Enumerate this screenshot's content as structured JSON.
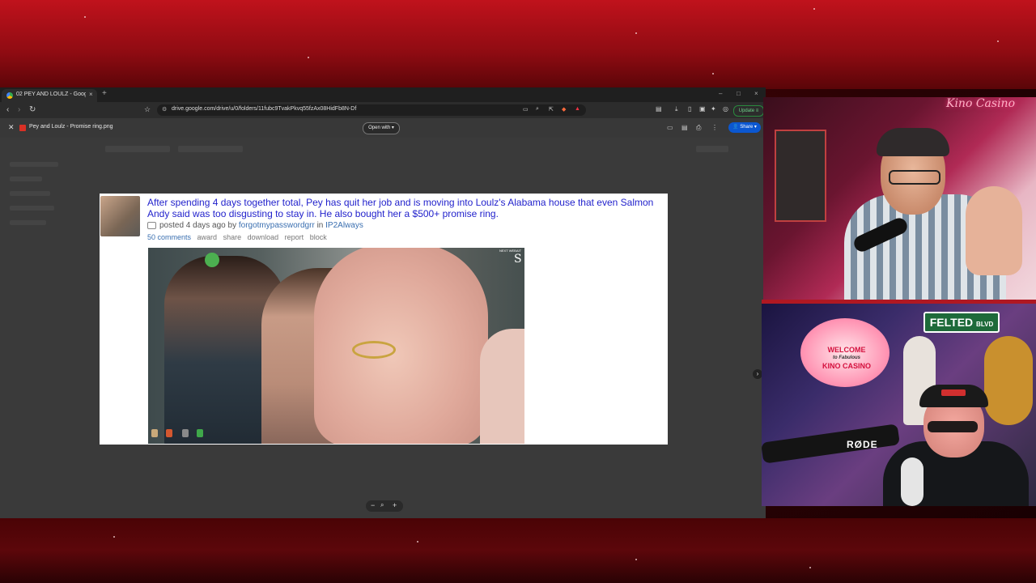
{
  "browser": {
    "tab_title": "02 PEY AND LOULZ - Google Dr",
    "tab_close": "×",
    "tab_new": "+",
    "url": "drive.google.com/drive/u/0/folders/11fubc9TvakPkvq55fzAx08HidFb8N-Df",
    "update_label": "Update"
  },
  "viewer": {
    "file_title": "Pey and Loulz - Promise ring.png",
    "open_with": "Open with",
    "share_label": "Share",
    "zoom_out": "−",
    "zoom_in": "+"
  },
  "post": {
    "title": "After spending 4 days together total, Pey has quit her job and is moving into Loulz's Alabama house that even Salmon Andy said was too disgusting to stay in. He also bought her a $500+ promise ring.",
    "posted": "posted 4 days ago by",
    "author": "forgotmypasswordgrr",
    "in_label": "in",
    "subreddit": "IP2Always",
    "comments": "50 comments",
    "actions": [
      "award",
      "share",
      "download",
      "report",
      "block"
    ],
    "photo_watermark": "S",
    "photo_tag": "NEXT WEBAIT"
  },
  "stream": {
    "logo": "Kino Casino",
    "sign_welcome": "WELCOME",
    "sign_to": "to Fabulous",
    "sign_name": "KINO CASINO",
    "street_sign": "FELTED",
    "street_suffix": "BLVD",
    "mic_brand": "RØDE"
  },
  "colors": {
    "accent_red": "#c0121c",
    "link_blue": "#2222cc",
    "share_blue": "#0b57d0"
  }
}
